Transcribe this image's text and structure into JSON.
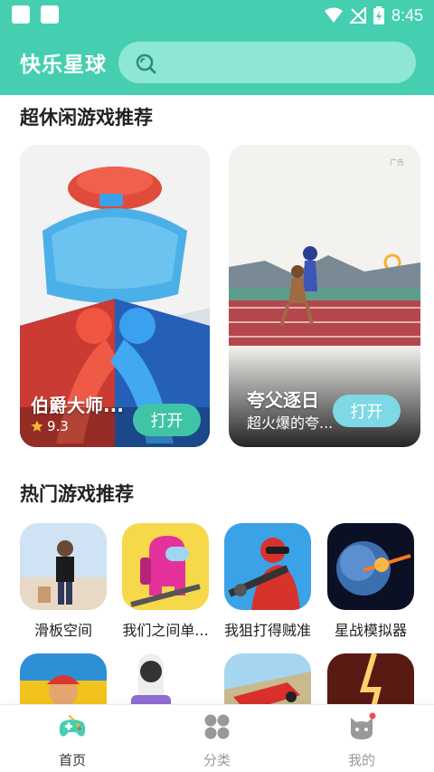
{
  "status_bar": {
    "time": "8:45"
  },
  "header": {
    "app_title": "快乐星球",
    "search_placeholder": ""
  },
  "sections": {
    "casual_title": "超休闲游戏推荐",
    "hot_title": "热门游戏推荐"
  },
  "featured": [
    {
      "title": "伯爵大师...",
      "rating": "9.3",
      "button": "打开"
    },
    {
      "title": "夸父逐日",
      "subtitle": "超火爆的夸...",
      "button": "打开"
    }
  ],
  "hot_games": [
    {
      "name": "滑板空间"
    },
    {
      "name": "我们之间单..."
    },
    {
      "name": "我狙打得贼准"
    },
    {
      "name": "星战模拟器"
    }
  ],
  "bottom_nav": [
    {
      "label": "首页",
      "icon": "gamepad-icon",
      "active": true
    },
    {
      "label": "分类",
      "icon": "category-icon",
      "active": false
    },
    {
      "label": "我的",
      "icon": "profile-icon",
      "active": false
    }
  ],
  "colors": {
    "accent": "#45cfb0",
    "search_bg": "#8ee7d4",
    "button": "#3fc5a6"
  }
}
